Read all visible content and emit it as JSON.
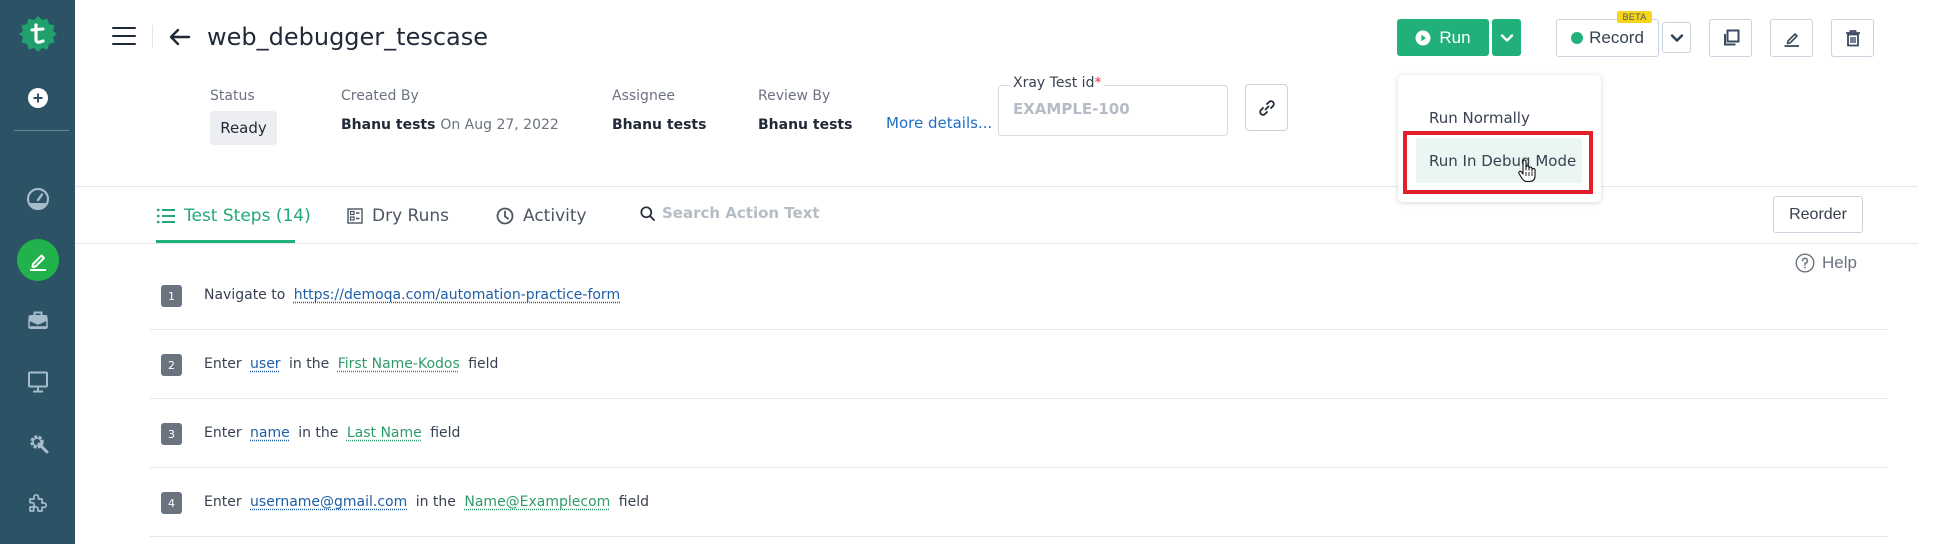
{
  "sidebar": {
    "items": [
      {
        "name": "logo",
        "icon": "testsigma-logo-icon"
      },
      {
        "name": "add",
        "icon": "plus-circle-icon"
      },
      {
        "name": "dashboard",
        "icon": "gauge-icon"
      },
      {
        "name": "test-development",
        "icon": "pencil-icon",
        "active": true
      },
      {
        "name": "test-management",
        "icon": "briefcase-icon"
      },
      {
        "name": "devices",
        "icon": "monitor-icon"
      },
      {
        "name": "settings",
        "icon": "gear-wrench-icon"
      },
      {
        "name": "addons",
        "icon": "puzzle-icon"
      }
    ]
  },
  "header": {
    "title": "web_debugger_tescase"
  },
  "meta": {
    "status_label": "Status",
    "status_value": "Ready",
    "created_by_label": "Created By",
    "created_by_value": "Bhanu tests",
    "created_on": "On Aug 27, 2022",
    "assignee_label": "Assignee",
    "assignee_value": "Bhanu tests",
    "review_by_label": "Review By",
    "review_by_value": "Bhanu tests",
    "more_details": "More details...",
    "xray_label": "Xray Test id",
    "xray_required": "*",
    "xray_placeholder": "EXAMPLE-100",
    "xray_value": ""
  },
  "toolbar": {
    "run_label": "Run",
    "record_label": "Record",
    "beta_badge": "BETA"
  },
  "run_menu": {
    "items": [
      "Run Normally",
      "Run In Debug Mode"
    ],
    "highlighted": "Run In Debug Mode"
  },
  "tabs": [
    {
      "label": "Test Steps (14)",
      "active": true
    },
    {
      "label": "Dry Runs",
      "active": false
    },
    {
      "label": "Activity",
      "active": false
    }
  ],
  "search": {
    "placeholder": "Search Action Text"
  },
  "reorder_label": "Reorder",
  "help_label": "Help",
  "colors": {
    "sidebar": "#2c5266",
    "accent": "#22b07a",
    "highlight_box": "#e3202a",
    "beta": "#f7d51d",
    "link": "#1e6ec8"
  },
  "steps": [
    {
      "num": "1",
      "parts": {
        "a": "Navigate to",
        "url": "https://demoqa.com/automation-practice-form"
      }
    },
    {
      "num": "2",
      "parts": {
        "a": "Enter",
        "param": "user",
        "b": "in the",
        "elem": "First Name-Kodos",
        "c": "field"
      }
    },
    {
      "num": "3",
      "parts": {
        "a": "Enter",
        "param": "name",
        "b": "in the",
        "elem": "Last Name",
        "c": "field"
      }
    },
    {
      "num": "4",
      "parts": {
        "a": "Enter",
        "param": "username@gmail.com",
        "b": "in the",
        "elem": "Name@Examplecom",
        "c": "field"
      }
    }
  ]
}
